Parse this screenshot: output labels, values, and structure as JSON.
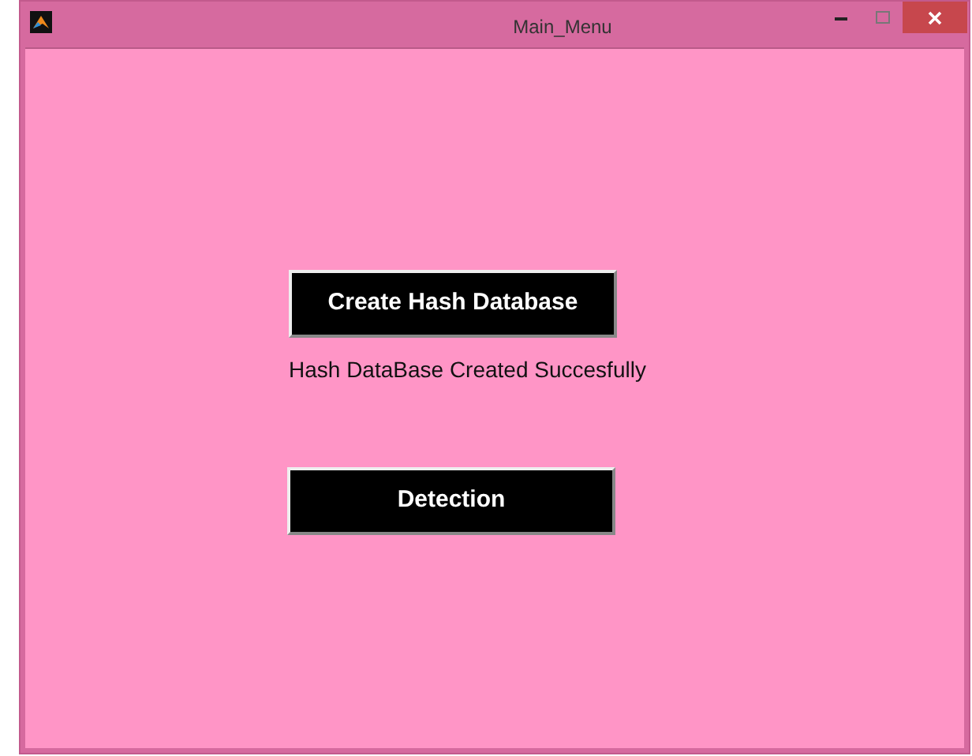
{
  "window": {
    "title": "Main_Menu"
  },
  "buttons": [
    {
      "label": "Create Hash Database"
    },
    {
      "label": "Detection"
    }
  ],
  "status_text": "Hash DataBase Created Succesfully"
}
